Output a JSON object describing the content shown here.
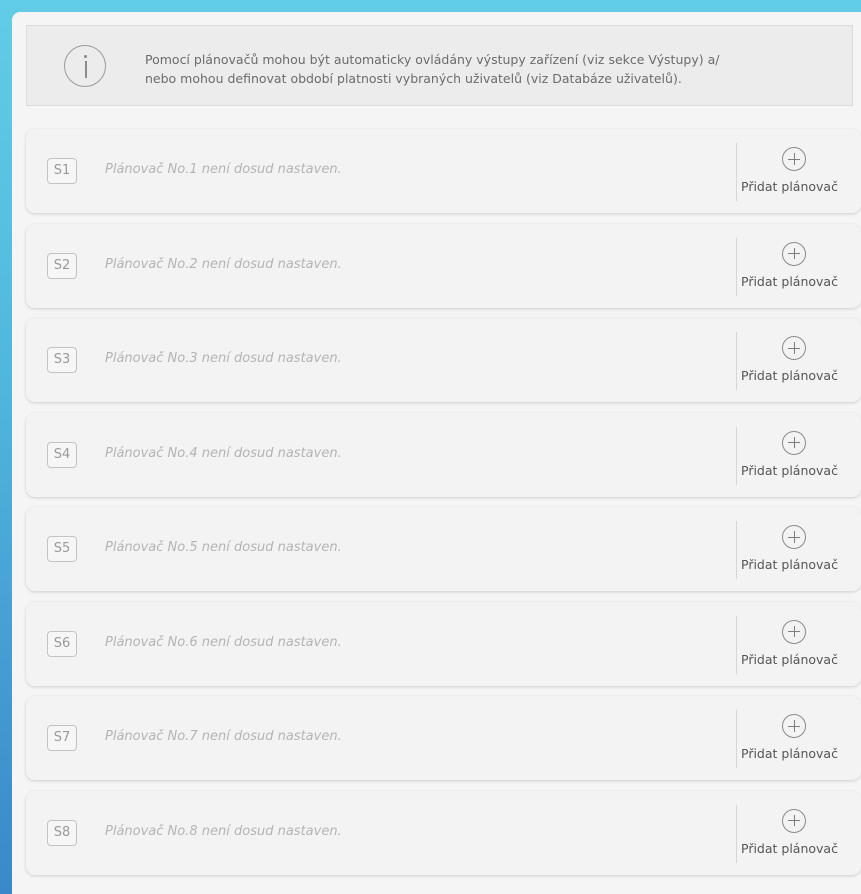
{
  "info": {
    "icon": "info-icon",
    "text": "Pomocí plánovačů mohou být automaticky ovládány výstupy zařízení (viz sekce Výstupy) a/\nnebo mohou definovat období platnosti vybraných uživatelů (viz Databáze uživatelů)."
  },
  "schedulers": [
    {
      "slot": "S1",
      "text": "Plánovač No.1 není dosud nastaven.",
      "add_label": "Přidat plánovač",
      "add_icon": "plus-circle-icon"
    },
    {
      "slot": "S2",
      "text": "Plánovač No.2 není dosud nastaven.",
      "add_label": "Přidat plánovač",
      "add_icon": "plus-circle-icon"
    },
    {
      "slot": "S3",
      "text": "Plánovač No.3 není dosud nastaven.",
      "add_label": "Přidat plánovač",
      "add_icon": "plus-circle-icon"
    },
    {
      "slot": "S4",
      "text": "Plánovač No.4 není dosud nastaven.",
      "add_label": "Přidat plánovač",
      "add_icon": "plus-circle-icon"
    },
    {
      "slot": "S5",
      "text": "Plánovač No.5 není dosud nastaven.",
      "add_label": "Přidat plánovač",
      "add_icon": "plus-circle-icon"
    },
    {
      "slot": "S6",
      "text": "Plánovač No.6 není dosud nastaven.",
      "add_label": "Přidat plánovač",
      "add_icon": "plus-circle-icon"
    },
    {
      "slot": "S7",
      "text": "Plánovač No.7 není dosud nastaven.",
      "add_label": "Přidat plánovač",
      "add_icon": "plus-circle-icon"
    },
    {
      "slot": "S8",
      "text": "Plánovač No.8 není dosud nastaven.",
      "add_label": "Přidat plánovač",
      "add_icon": "plus-circle-icon"
    }
  ],
  "colors": {
    "background_top": "#62cde6",
    "background_bottom": "#3a88c9",
    "panel": "#f5f5f5",
    "card": "#f3f3f3",
    "muted_text": "#b4b4b4"
  }
}
